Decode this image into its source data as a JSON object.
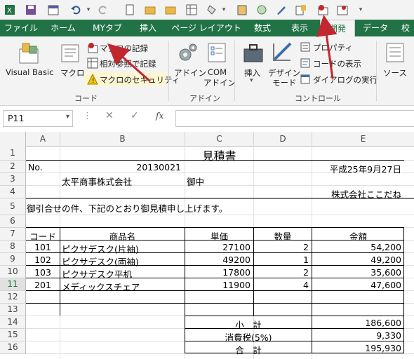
{
  "tabs": [
    "ファイル",
    "ホーム",
    "MYタブ",
    "挿入",
    "ページ レイアウト",
    "数式",
    "表示",
    "開発",
    "データ",
    "校"
  ],
  "ribbon": {
    "visual_basic": "Visual Basic",
    "macro": "マクロ",
    "record_macro": "マクロの記録",
    "relative_ref": "相対参照で記録",
    "macro_security": "マクロのセキュリティ",
    "group_code": "コード",
    "addin": "アドイン",
    "com_addin_1": "COM",
    "com_addin_2": "アドイン",
    "group_addin": "アドイン",
    "insert": "挿入",
    "design_1": "デザイン",
    "design_2": "モード",
    "properties": "プロパティ",
    "view_code": "コードの表示",
    "run_dialog": "ダイアログの実行",
    "group_control": "コントロール",
    "source": "ソース"
  },
  "formula_bar": {
    "name_box": "P11",
    "fx": "fx",
    "formula": ""
  },
  "columns": [
    "A",
    "B",
    "C",
    "D",
    "E"
  ],
  "rows": [
    "1",
    "2",
    "3",
    "4",
    "5",
    "6",
    "7",
    "8",
    "9",
    "10",
    "11",
    "12",
    "13",
    "14",
    "15",
    "16"
  ],
  "sheet": {
    "title": "見積書",
    "no_label": "No.",
    "no_value": "20130021",
    "date": "平成25年9月27日",
    "customer": "太平商事株式会社",
    "onchu": "御中",
    "company": "株式会社ここだね",
    "greeting": "御引合せの件、下記のとおり御見積申し上げます。",
    "headers": {
      "code": "コード",
      "name": "商品名",
      "price": "単価",
      "qty": "数量",
      "amount": "金額"
    },
    "items": [
      {
        "code": "101",
        "name": "ピクサデスク(片袖)",
        "price": "27100",
        "qty": "2",
        "amount": "54,200"
      },
      {
        "code": "102",
        "name": "ピクサデスク(両袖)",
        "price": "49200",
        "qty": "1",
        "amount": "49,200"
      },
      {
        "code": "103",
        "name": "ピクサデスク平机",
        "price": "17800",
        "qty": "2",
        "amount": "35,600"
      },
      {
        "code": "201",
        "name": "メディックスチェア",
        "price": "11900",
        "qty": "4",
        "amount": "47,600"
      }
    ],
    "subtotal_label": "小　計",
    "subtotal": "186,600",
    "tax_label": "消費税(5%)",
    "tax": "9,330",
    "total_label": "合　計",
    "total": "195,930"
  },
  "colors": {
    "excel_green": "#217346",
    "arrow_red": "#c0282d"
  }
}
